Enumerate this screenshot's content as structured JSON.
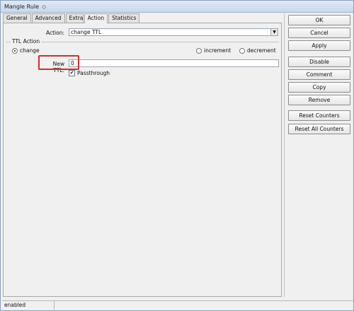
{
  "window": {
    "title": "Mangle Rule",
    "title_icon": "diamond-icon"
  },
  "tabs": [
    {
      "label": "General",
      "active": false
    },
    {
      "label": "Advanced",
      "active": false
    },
    {
      "label": "Extra",
      "active": false
    },
    {
      "label": "Action",
      "active": true
    },
    {
      "label": "Statistics",
      "active": false
    }
  ],
  "form": {
    "action_label": "Action:",
    "action_value": "change TTL",
    "ttl_group_label": "TTL Action",
    "radio_change": "change",
    "radio_increment": "increment",
    "radio_decrement": "decrement",
    "new_ttl_label": "New TTL:",
    "new_ttl_value": "0",
    "passthrough_label": "Passthrough",
    "passthrough_checked": true
  },
  "buttons": {
    "ok": "OK",
    "cancel": "Cancel",
    "apply": "Apply",
    "disable": "Disable",
    "comment": "Comment",
    "copy": "Copy",
    "remove": "Remove",
    "reset_counters": "Reset Counters",
    "reset_all_counters": "Reset All Counters"
  },
  "status": {
    "state": "enabled"
  },
  "colors": {
    "highlight": "#d62d2d"
  }
}
